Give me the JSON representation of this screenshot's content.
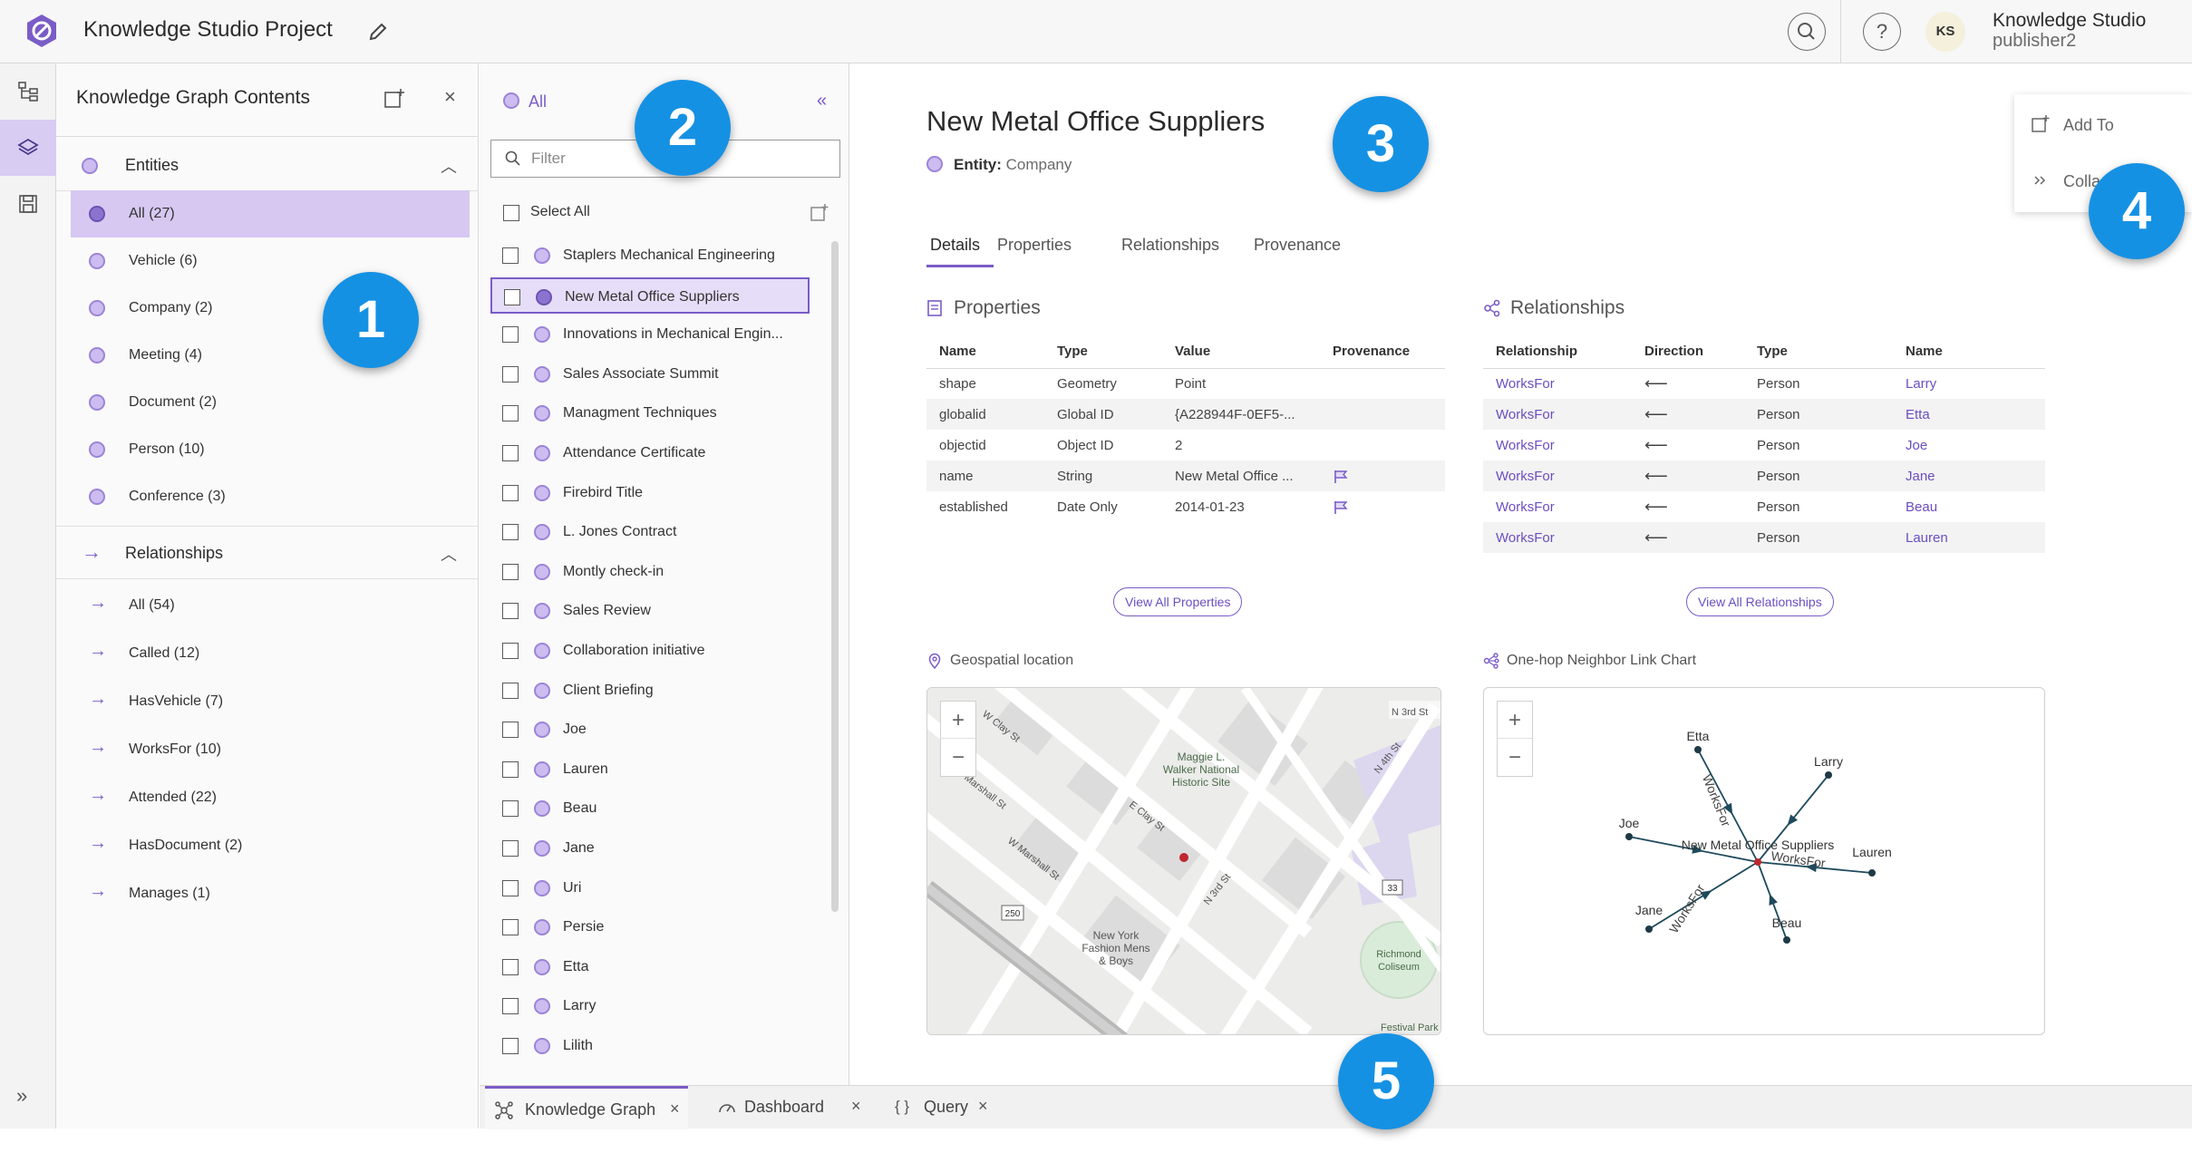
{
  "header": {
    "title": "Knowledge Studio Project",
    "avatar_initials": "KS",
    "user_name": "Knowledge Studio",
    "user_role": "publisher2"
  },
  "contents": {
    "title": "Knowledge Graph Contents",
    "entities_label": "Entities",
    "entities": [
      {
        "label": "All (27)"
      },
      {
        "label": "Vehicle (6)"
      },
      {
        "label": "Company (2)"
      },
      {
        "label": "Meeting (4)"
      },
      {
        "label": "Document (2)"
      },
      {
        "label": "Person (10)"
      },
      {
        "label": "Conference (3)"
      }
    ],
    "relationships_label": "Relationships",
    "relationships": [
      {
        "label": "All (54)"
      },
      {
        "label": "Called (12)"
      },
      {
        "label": "HasVehicle (7)"
      },
      {
        "label": "WorksFor (10)"
      },
      {
        "label": "Attended (22)"
      },
      {
        "label": "HasDocument (2)"
      },
      {
        "label": "Manages (1)"
      }
    ]
  },
  "list": {
    "filter_label": "All",
    "filter_placeholder": "Filter",
    "select_all": "Select All",
    "items": [
      "Staplers Mechanical Engineering",
      "New Metal Office Suppliers",
      "Innovations in Mechanical Engin...",
      "Sales Associate Summit",
      "Managment Techniques",
      "Attendance Certificate",
      "Firebird Title",
      "L. Jones Contract",
      "Montly check-in",
      "Sales Review",
      "Collaboration initiative",
      "Client Briefing",
      "Joe",
      "Lauren",
      "Beau",
      "Jane",
      "Uri",
      "Persie",
      "Etta",
      "Larry",
      "Lilith"
    ]
  },
  "details": {
    "title": "New Metal Office Suppliers",
    "entity_label": "Entity:",
    "entity_type": "Company",
    "tabs": [
      "Details",
      "Properties",
      "Relationships",
      "Provenance"
    ],
    "properties_title": "Properties",
    "properties_headers": [
      "Name",
      "Type",
      "Value",
      "Provenance"
    ],
    "properties": [
      {
        "name": "shape",
        "type": "Geometry",
        "value": "Point",
        "prov": false
      },
      {
        "name": "globalid",
        "type": "Global ID",
        "value": "{A228944F-0EF5-...",
        "prov": false
      },
      {
        "name": "objectid",
        "type": "Object ID",
        "value": "2",
        "prov": false
      },
      {
        "name": "name",
        "type": "String",
        "value": "New Metal Office ...",
        "prov": true
      },
      {
        "name": "established",
        "type": "Date Only",
        "value": "2014-01-23",
        "prov": true
      }
    ],
    "relationships_title": "Relationships",
    "relationships_headers": [
      "Relationship",
      "Direction",
      "Type",
      "Name"
    ],
    "relationships": [
      {
        "rel": "WorksFor",
        "dir": "⟵",
        "type": "Person",
        "name": "Larry"
      },
      {
        "rel": "WorksFor",
        "dir": "⟵",
        "type": "Person",
        "name": "Etta"
      },
      {
        "rel": "WorksFor",
        "dir": "⟵",
        "type": "Person",
        "name": "Joe"
      },
      {
        "rel": "WorksFor",
        "dir": "⟵",
        "type": "Person",
        "name": "Jane"
      },
      {
        "rel": "WorksFor",
        "dir": "⟵",
        "type": "Person",
        "name": "Beau"
      },
      {
        "rel": "WorksFor",
        "dir": "⟵",
        "type": "Person",
        "name": "Lauren"
      }
    ],
    "view_all_properties": "View All Properties",
    "view_all_relationships": "View All Relationships",
    "geo_title": "Geospatial location",
    "link_chart_title": "One-hop Neighbor Link Chart"
  },
  "map": {
    "labels": [
      {
        "text": "W Clay St"
      },
      {
        "text": "Maggie L."
      },
      {
        "text": "Walker National"
      },
      {
        "text": "Historic Site"
      },
      {
        "text": "N 3rd St"
      },
      {
        "text": "N 4th St"
      },
      {
        "text": "E Clay St"
      },
      {
        "text": "Marshall St"
      },
      {
        "text": "W Marshall St"
      },
      {
        "text": "N 3rd St"
      },
      {
        "text": "New York"
      },
      {
        "text": "Fashion Mens"
      },
      {
        "text": "& Boys"
      },
      {
        "text": "Richmond"
      },
      {
        "text": "Coliseum"
      },
      {
        "text": "Festival Park"
      },
      {
        "text": "250"
      },
      {
        "text": "33"
      }
    ]
  },
  "link_chart": {
    "center_label": "New Metal Office Suppliers",
    "nodes": [
      {
        "label": "Etta"
      },
      {
        "label": "Larry"
      },
      {
        "label": "Joe"
      },
      {
        "label": "Lauren"
      },
      {
        "label": "Jane"
      },
      {
        "label": "Beau"
      }
    ],
    "edge_label": "WorksFor"
  },
  "float_menu": {
    "add_to": "Add To",
    "collapse": "Colla"
  },
  "bottom_tabs": [
    {
      "label": "Knowledge Graph"
    },
    {
      "label": "Dashboard"
    },
    {
      "label": "Query"
    }
  ],
  "callouts": [
    "1",
    "2",
    "3",
    "4",
    "5"
  ],
  "colors": {
    "accent": "#7a5cc7",
    "callout": "#1591e4",
    "selected_bg": "#d6c8f1"
  }
}
